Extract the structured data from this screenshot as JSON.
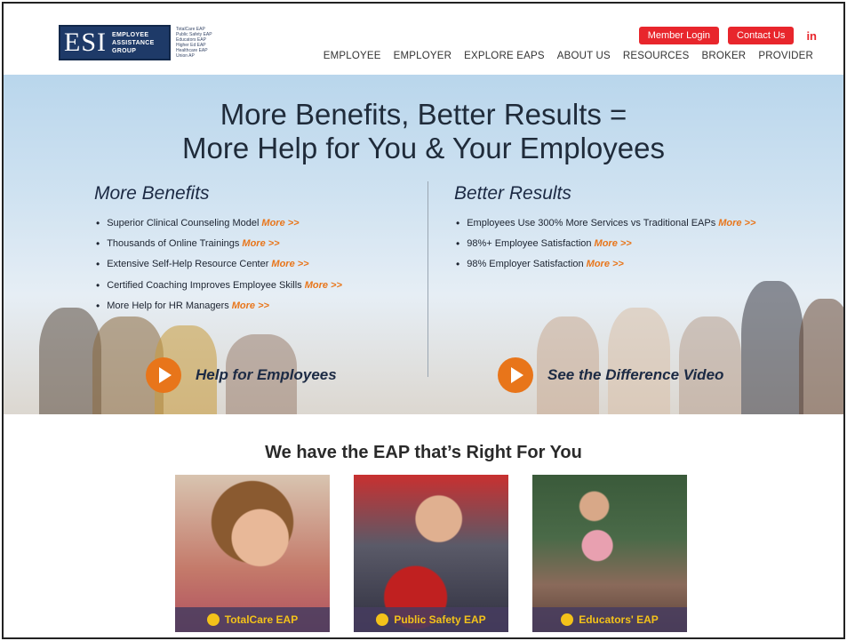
{
  "header": {
    "logo": {
      "mark": "ESI",
      "subtitle": [
        "EMPLOYEE",
        "ASSISTANCE",
        "GROUP"
      ],
      "taglines": [
        "TotalCare EAP",
        "Public Safety EAP",
        "Educators EAP",
        "Higher Ed EAP",
        "Healthcare EAP",
        "Union AP"
      ]
    },
    "member_login": "Member Login",
    "contact_us": "Contact Us",
    "linkedin": "in",
    "nav": [
      "EMPLOYEE",
      "EMPLOYER",
      "EXPLORE EAPS",
      "ABOUT US",
      "RESOURCES",
      "BROKER",
      "PROVIDER"
    ]
  },
  "hero": {
    "title_line1": "More Benefits, Better Results =",
    "title_line2": "More Help for You & Your Employees",
    "left_heading": "More Benefits",
    "left_items": [
      {
        "text": "Superior Clinical Counseling Model",
        "more": "More >>"
      },
      {
        "text": "Thousands of Online Trainings",
        "more": "More >>"
      },
      {
        "text": "Extensive Self-Help Resource Center",
        "more": "More >>"
      },
      {
        "text": "Certified Coaching Improves Employee Skills",
        "more": "More >>"
      },
      {
        "text": "More Help for HR Managers",
        "more": "More >>"
      }
    ],
    "right_heading": "Better Results",
    "right_items": [
      {
        "text": "Employees Use 300% More Services vs Traditional EAPs",
        "more": "More >>"
      },
      {
        "text": "98%+ Employee Satisfaction",
        "more": "More >>"
      },
      {
        "text": "98% Employer Satisfaction",
        "more": "More >>"
      }
    ],
    "video_left": "Help for Employees",
    "video_right": "See the Difference Video"
  },
  "eap": {
    "title": "We have the EAP that’s Right For You",
    "cards": [
      {
        "label": "TotalCare EAP"
      },
      {
        "label": "Public Safety EAP"
      },
      {
        "label": "Educators' EAP"
      }
    ]
  },
  "colors": {
    "brand_red": "#e8262c",
    "accent_orange": "#e8751a",
    "navy": "#1e3a68",
    "card_label": "#f3c21a"
  }
}
